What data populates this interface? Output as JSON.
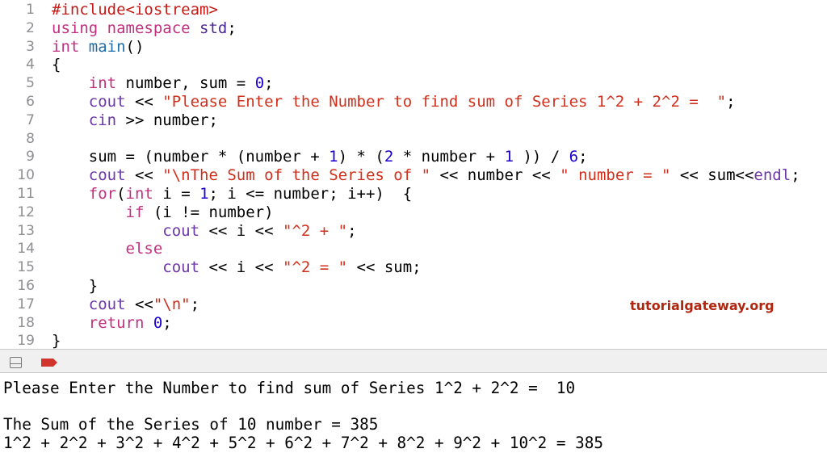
{
  "editor": {
    "lines": [
      [
        [
          "#include<iostream>",
          "pp"
        ]
      ],
      [
        [
          "using namespace ",
          "kw"
        ],
        [
          "std",
          "ty"
        ],
        [
          ";",
          "pl"
        ]
      ],
      [
        [
          "int ",
          "kw"
        ],
        [
          "main",
          "fn"
        ],
        [
          "()",
          "pl"
        ]
      ],
      [
        [
          "{",
          "pl"
        ]
      ],
      [
        [
          "    ",
          "pl"
        ],
        [
          "int ",
          "kw"
        ],
        [
          "number, sum = ",
          "pl"
        ],
        [
          "0",
          "num"
        ],
        [
          ";",
          "pl"
        ]
      ],
      [
        [
          "    ",
          "pl"
        ],
        [
          "cout",
          "id"
        ],
        [
          " << ",
          "pl"
        ],
        [
          "\"Please Enter the Number to find sum of Series 1^2 + 2^2 =  \"",
          "str"
        ],
        [
          ";",
          "pl"
        ]
      ],
      [
        [
          "    ",
          "pl"
        ],
        [
          "cin",
          "id"
        ],
        [
          " >> number;",
          "pl"
        ]
      ],
      [
        [
          "",
          "pl"
        ]
      ],
      [
        [
          "    sum = (number * (number + ",
          "pl"
        ],
        [
          "1",
          "num"
        ],
        [
          ") * (",
          "pl"
        ],
        [
          "2",
          "num"
        ],
        [
          " * number + ",
          "pl"
        ],
        [
          "1",
          "num"
        ],
        [
          " )) / ",
          "pl"
        ],
        [
          "6",
          "num"
        ],
        [
          ";",
          "pl"
        ]
      ],
      [
        [
          "    ",
          "pl"
        ],
        [
          "cout",
          "id"
        ],
        [
          " << ",
          "pl"
        ],
        [
          "\"\\nThe Sum of the Series of \"",
          "str"
        ],
        [
          " << number << ",
          "pl"
        ],
        [
          "\" number = \"",
          "str"
        ],
        [
          " << sum<<",
          "pl"
        ],
        [
          "endl",
          "id"
        ],
        [
          ";",
          "pl"
        ]
      ],
      [
        [
          "    ",
          "pl"
        ],
        [
          "for",
          "kw"
        ],
        [
          "(",
          "pl"
        ],
        [
          "int ",
          "kw"
        ],
        [
          "i = ",
          "pl"
        ],
        [
          "1",
          "num"
        ],
        [
          "; i <= number; i++)  {",
          "pl"
        ]
      ],
      [
        [
          "        ",
          "pl"
        ],
        [
          "if",
          "kw"
        ],
        [
          " (i != number)",
          "pl"
        ]
      ],
      [
        [
          "            ",
          "pl"
        ],
        [
          "cout",
          "id"
        ],
        [
          " << i << ",
          "pl"
        ],
        [
          "\"^2 + \"",
          "str"
        ],
        [
          ";",
          "pl"
        ]
      ],
      [
        [
          "        ",
          "pl"
        ],
        [
          "else",
          "kw"
        ]
      ],
      [
        [
          "            ",
          "pl"
        ],
        [
          "cout",
          "id"
        ],
        [
          " << i << ",
          "pl"
        ],
        [
          "\"^2 = \"",
          "str"
        ],
        [
          " << sum;",
          "pl"
        ]
      ],
      [
        [
          "    }",
          "pl"
        ]
      ],
      [
        [
          "    ",
          "pl"
        ],
        [
          "cout",
          "id"
        ],
        [
          " <<",
          "pl"
        ],
        [
          "\"\\n\"",
          "str"
        ],
        [
          ";",
          "pl"
        ]
      ],
      [
        [
          "    ",
          "pl"
        ],
        [
          "return ",
          "kw"
        ],
        [
          "0",
          "num"
        ],
        [
          ";",
          "pl"
        ]
      ],
      [
        [
          "}",
          "pl"
        ]
      ]
    ]
  },
  "watermark": "tutorialgateway.org",
  "console": {
    "lines": [
      "Please Enter the Number to find sum of Series 1^2 + 2^2 =  10",
      "",
      "The Sum of the Series of 10 number = 385",
      "1^2 + 2^2 + 3^2 + 4^2 + 5^2 + 6^2 + 7^2 + 8^2 + 9^2 + 10^2 = 385"
    ]
  },
  "colors": {
    "breakpoint": "#d0342c",
    "keyword": "#c1307f",
    "string": "#d12f1b",
    "number": "#1c00cf"
  }
}
